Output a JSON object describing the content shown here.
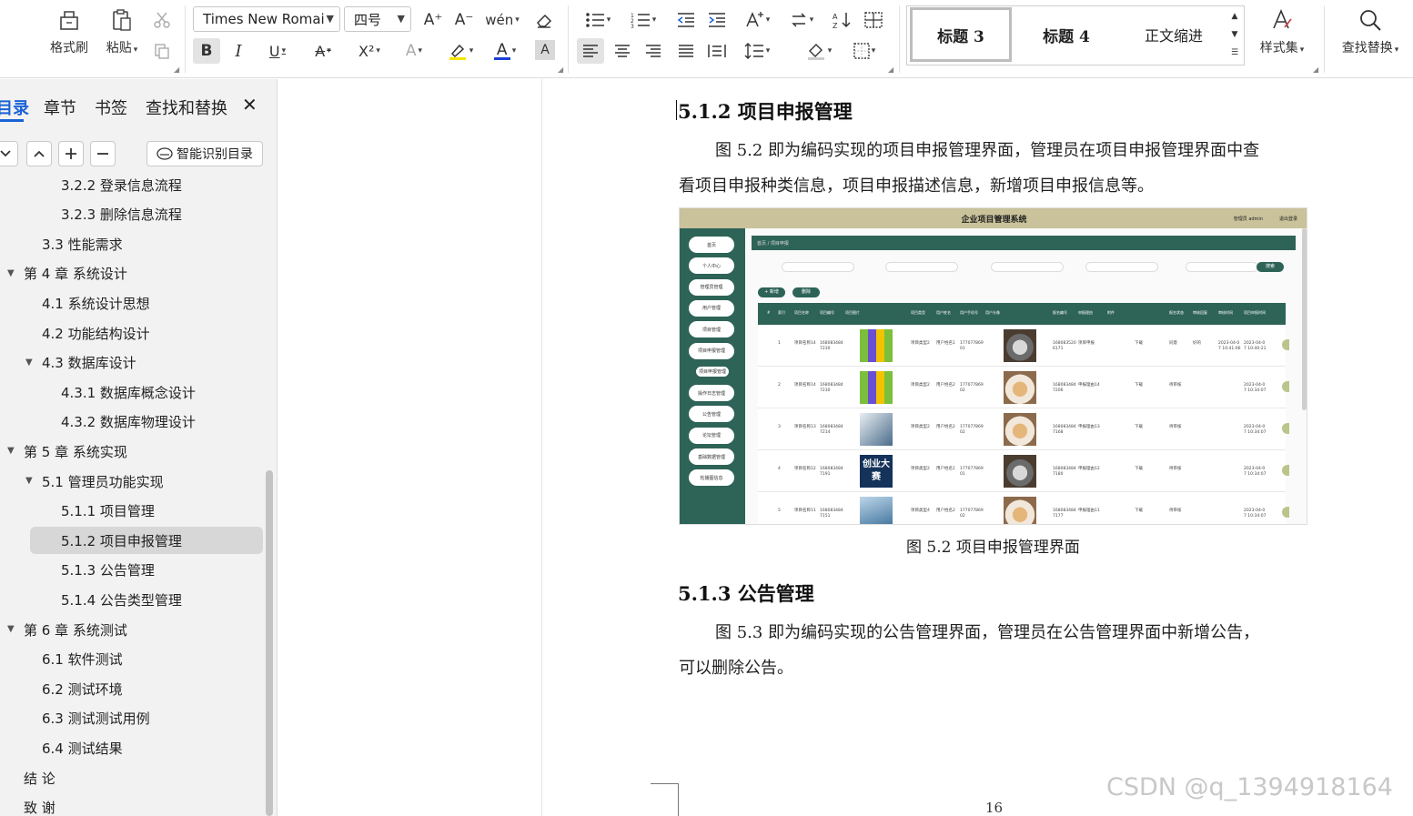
{
  "toolbar": {
    "format_painter": "格式刷",
    "paste": "粘贴",
    "font_name": "Times New Romai",
    "font_size": "四号",
    "styles": [
      "标题 3",
      "标题 4",
      "正文缩进"
    ],
    "style_set": "样式集",
    "find_replace": "查找替换"
  },
  "nav": {
    "tabs": [
      "目录",
      "章节",
      "书签",
      "查找和替换"
    ],
    "smart_toc": "智能识别目录",
    "items": [
      {
        "label": "3.2.2  登录信息流程",
        "level": 3
      },
      {
        "label": "3.2.3  删除信息流程",
        "level": 3
      },
      {
        "label": "3.3  性能需求",
        "level": 2
      },
      {
        "label": "第 4 章  系统设计",
        "level": 1
      },
      {
        "label": "4.1  系统设计思想",
        "level": 2
      },
      {
        "label": "4.2  功能结构设计",
        "level": 2
      },
      {
        "label": "4.3  数据库设计",
        "level": 2
      },
      {
        "label": "4.3.1  数据库概念设计",
        "level": 3
      },
      {
        "label": "4.3.2  数据库物理设计",
        "level": 3
      },
      {
        "label": "第 5 章  系统实现",
        "level": 1
      },
      {
        "label": "5.1  管理员功能实现",
        "level": 2
      },
      {
        "label": "5.1.1  项目管理",
        "level": 3
      },
      {
        "label": "5.1.2  项目申报管理",
        "level": 3
      },
      {
        "label": "5.1.3  公告管理",
        "level": 3
      },
      {
        "label": "5.1.4  公告类型管理",
        "level": 3
      },
      {
        "label": "第 6 章  系统测试",
        "level": 1
      },
      {
        "label": "6.1 软件测试",
        "level": 2
      },
      {
        "label": "6.2 测试环境",
        "level": 2
      },
      {
        "label": "6.3 测试测试用例",
        "level": 2
      },
      {
        "label": "6.4 测试结果",
        "level": 2
      },
      {
        "label": "结  论",
        "level": 1
      },
      {
        "label": "致  谢",
        "level": 1
      }
    ],
    "selected_index": 12
  },
  "doc": {
    "heading_marker": "H3",
    "h_512": "5.1.2  项目申报管理",
    "p1_line1": "图 5.2  即为编码实现的项目申报管理界面，管理员在项目申报管理界面中查",
    "p1_line2": "看项目申报种类信息，项目申报描述信息，新增项目申报信息等。",
    "fig_caption": "图 5.2  项目申报管理界面",
    "h_513": "5.1.3  公告管理",
    "p2_line1": "图 5.3  即为编码实现的公告管理界面，管理员在公告管理界面中新增公告，",
    "p2_line2": "可以删除公告。",
    "page_number": "16"
  },
  "embedded": {
    "title": "企业项目管理系统",
    "user": "管理员 admin",
    "logout": "退出登录",
    "breadcrumb": "首页  /  项目申报",
    "search_btn": "搜索",
    "add_btn": "+ 新增",
    "del_btn": "删除",
    "menu": [
      "首页",
      "个人中心",
      "管理员管理",
      "用户管理",
      "项目管理",
      "项目申报管理",
      "项目申报管理",
      "操作日志管理",
      "公告管理",
      "论坛管理",
      "基础数据管理",
      "轮播图信息"
    ],
    "columns": [
      "索引",
      "项目名称",
      "项目编号",
      "项目图片",
      "项目类型",
      "用户姓名",
      "用户手机号",
      "用户头像",
      "报名编号",
      "申报理由",
      "附件",
      "报名状态",
      "审核回复",
      "审核时间",
      "项目申报时间"
    ],
    "rows": [
      {
        "idx": "1",
        "name": "项目名称14",
        "code": "1680834847230",
        "type": "项目类型2",
        "uname": "用户姓名1",
        "phone": "17707786901",
        "bno": "1680835206171",
        "reason": "项目申报",
        "file": "下载",
        "status": "同意",
        "reply": "好的",
        "time1": "2023-04-07 10:41:06",
        "time2": "2023-04-07 10:40:21",
        "img": "tiles",
        "avatar": "cat1"
      },
      {
        "idx": "2",
        "name": "项目名称14",
        "code": "1680834847230",
        "type": "项目类型2",
        "uname": "用户姓名2",
        "phone": "17707786902",
        "bno": "1680834847206",
        "reason": "申报理由14",
        "file": "下载",
        "status": "待审核",
        "reply": "",
        "time1": "",
        "time2": "2023-04-07 10:34:07",
        "img": "tiles",
        "avatar": "cat2"
      },
      {
        "idx": "3",
        "name": "项目名称13",
        "code": "1680834847214",
        "type": "项目类型2",
        "uname": "用户姓名2",
        "phone": "17707786902",
        "bno": "1680834847168",
        "reason": "申报理由13",
        "file": "下载",
        "status": "待审核",
        "reply": "",
        "time1": "",
        "time2": "2023-04-07 10:34:07",
        "img": "photo",
        "avatar": "cat2"
      },
      {
        "idx": "4",
        "name": "项目名称12",
        "code": "1680834847191",
        "type": "项目类型2",
        "uname": "用户姓名1",
        "phone": "17707786901",
        "bno": "1680834847180",
        "reason": "申报理由12",
        "file": "下载",
        "status": "待审核",
        "reply": "",
        "time1": "",
        "time2": "2023-04-07 10:34:07",
        "img": "poster",
        "avatar": "cat1"
      },
      {
        "idx": "5",
        "name": "项目名称11",
        "code": "1680834847151",
        "type": "项目类型4",
        "uname": "用户姓名2",
        "phone": "17707786902",
        "bno": "1680834847177",
        "reason": "申报理由11",
        "file": "下载",
        "status": "待审核",
        "reply": "",
        "time1": "",
        "time2": "2023-04-07 10:34:07",
        "img": "blue",
        "avatar": "cat2"
      }
    ],
    "poster_text": "创业大赛"
  },
  "watermark": "CSDN @q_1394918164",
  "colors": {
    "accent": "#1a63d6",
    "embedded_header": "#c9c29a",
    "embedded_sidebar": "#2e6357"
  }
}
